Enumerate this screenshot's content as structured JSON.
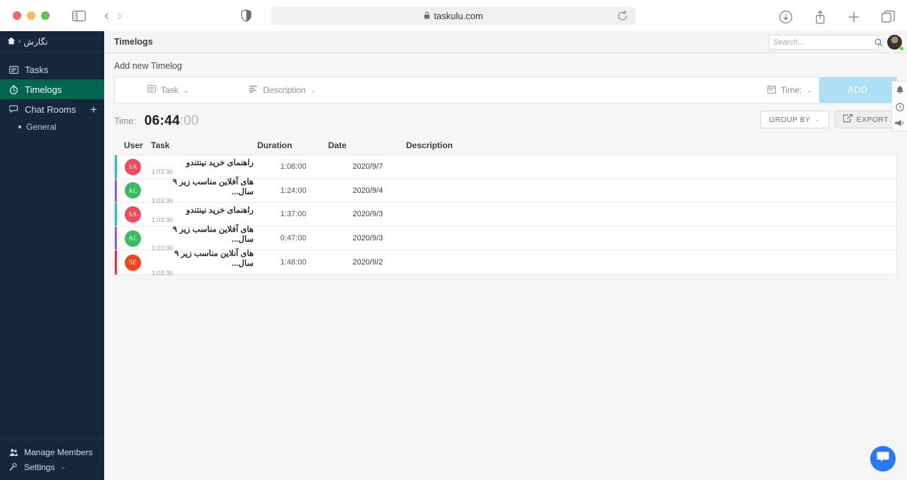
{
  "browser": {
    "url": "taskulu.com",
    "lock_icon": "lock-icon",
    "traffic_lights": [
      "close",
      "minimize",
      "zoom"
    ],
    "icons": {
      "sidebar_toggle": "sidebar-toggle-icon",
      "back": "‹",
      "forward": "›",
      "shield": "privacy-shield-icon",
      "reload": "reload-icon",
      "downloads": "downloads-icon",
      "share": "share-icon",
      "new_tab": "plus-icon",
      "tab_overview": "tab-overview-icon"
    }
  },
  "sidebar": {
    "breadcrumb": {
      "home_icon": "home-icon",
      "separator": "›",
      "project": "نگارش"
    },
    "items": [
      {
        "label": "Tasks",
        "icon": "tasks-icon",
        "active": false
      },
      {
        "label": "Timelogs",
        "icon": "stopwatch-icon",
        "active": true
      },
      {
        "label": "Chat Rooms",
        "icon": "chat-icon",
        "active": false,
        "has_add": true
      }
    ],
    "subitems": [
      {
        "label": "General"
      }
    ],
    "footer": [
      {
        "label": "Manage Members",
        "icon": "members-icon"
      },
      {
        "label": "Settings",
        "icon": "settings-icon",
        "caret": "⌄"
      }
    ]
  },
  "topbar": {
    "title": "Timelogs",
    "search_placeholder": "Search...",
    "search_value": "",
    "search_icon": "search-icon",
    "avatar": "user-avatar",
    "status": "online"
  },
  "add_timelog": {
    "section_label": "Add new Timelog",
    "task_field": {
      "label": "Task:",
      "display": "Task",
      "icon": "task-icon",
      "caret": "⌄"
    },
    "description_field": {
      "label": "Description",
      "icon": "description-icon",
      "caret": "⌄"
    },
    "time_field": {
      "label": "Time:",
      "icon": "calendar-icon",
      "caret": "⌄"
    },
    "add_button": "ADD",
    "add_button_color": "#aee0f5"
  },
  "summary": {
    "time_label": "Time:",
    "time_main": "06:44",
    "time_seconds": ":00",
    "group_by_button": "GROUP BY",
    "group_by_caret": "⌄",
    "export_button": "EXPORT",
    "export_icon": "export-icon"
  },
  "table": {
    "columns": [
      "User",
      "Task",
      "Duration",
      "Date",
      "Description"
    ],
    "rows": [
      {
        "initials": "SA",
        "avatar_color": "#ef4b5b",
        "bar_color": "#1ac6c6",
        "task": "راهنمای خرید نینتندو",
        "task_sub": "1:03:36",
        "duration": "1:08:00",
        "date": "2020/9/7",
        "description": ""
      },
      {
        "initials": "AL",
        "avatar_color": "#35bd5f",
        "bar_color": "#8b5cf6",
        "task": "های آفلاین مناسب زیر ۹ سال...",
        "task_sub": "1:03:36",
        "duration": "1:24:00",
        "date": "2020/9/4",
        "description": ""
      },
      {
        "initials": "SA",
        "avatar_color": "#ef4b5b",
        "bar_color": "#1ac6c6",
        "task": "راهنمای خرید نینتندو",
        "task_sub": "1:03:36",
        "duration": "1:37:00",
        "date": "2020/9/3",
        "description": ""
      },
      {
        "initials": "AL",
        "avatar_color": "#35bd5f",
        "bar_color": "#8b5cf6",
        "task": "های آفلاین مناسب زیر ۹ سال...",
        "task_sub": "1:03:36",
        "duration": "0:47:00",
        "date": "2020/9/3",
        "description": ""
      },
      {
        "initials": "SE",
        "avatar_color": "#f5451f",
        "bar_color": "#ef2b4e",
        "task": "های آنلاین مناسب زیر ۹ سال...",
        "task_sub": "1:03:36",
        "duration": "1:48:00",
        "date": "2020/9/2",
        "description": ""
      }
    ]
  },
  "right_rail": {
    "icons": [
      "bell-icon",
      "clock-icon",
      "megaphone-icon"
    ]
  },
  "fab": {
    "icon": "chat-bubble-icon",
    "color": "#2979f2"
  }
}
